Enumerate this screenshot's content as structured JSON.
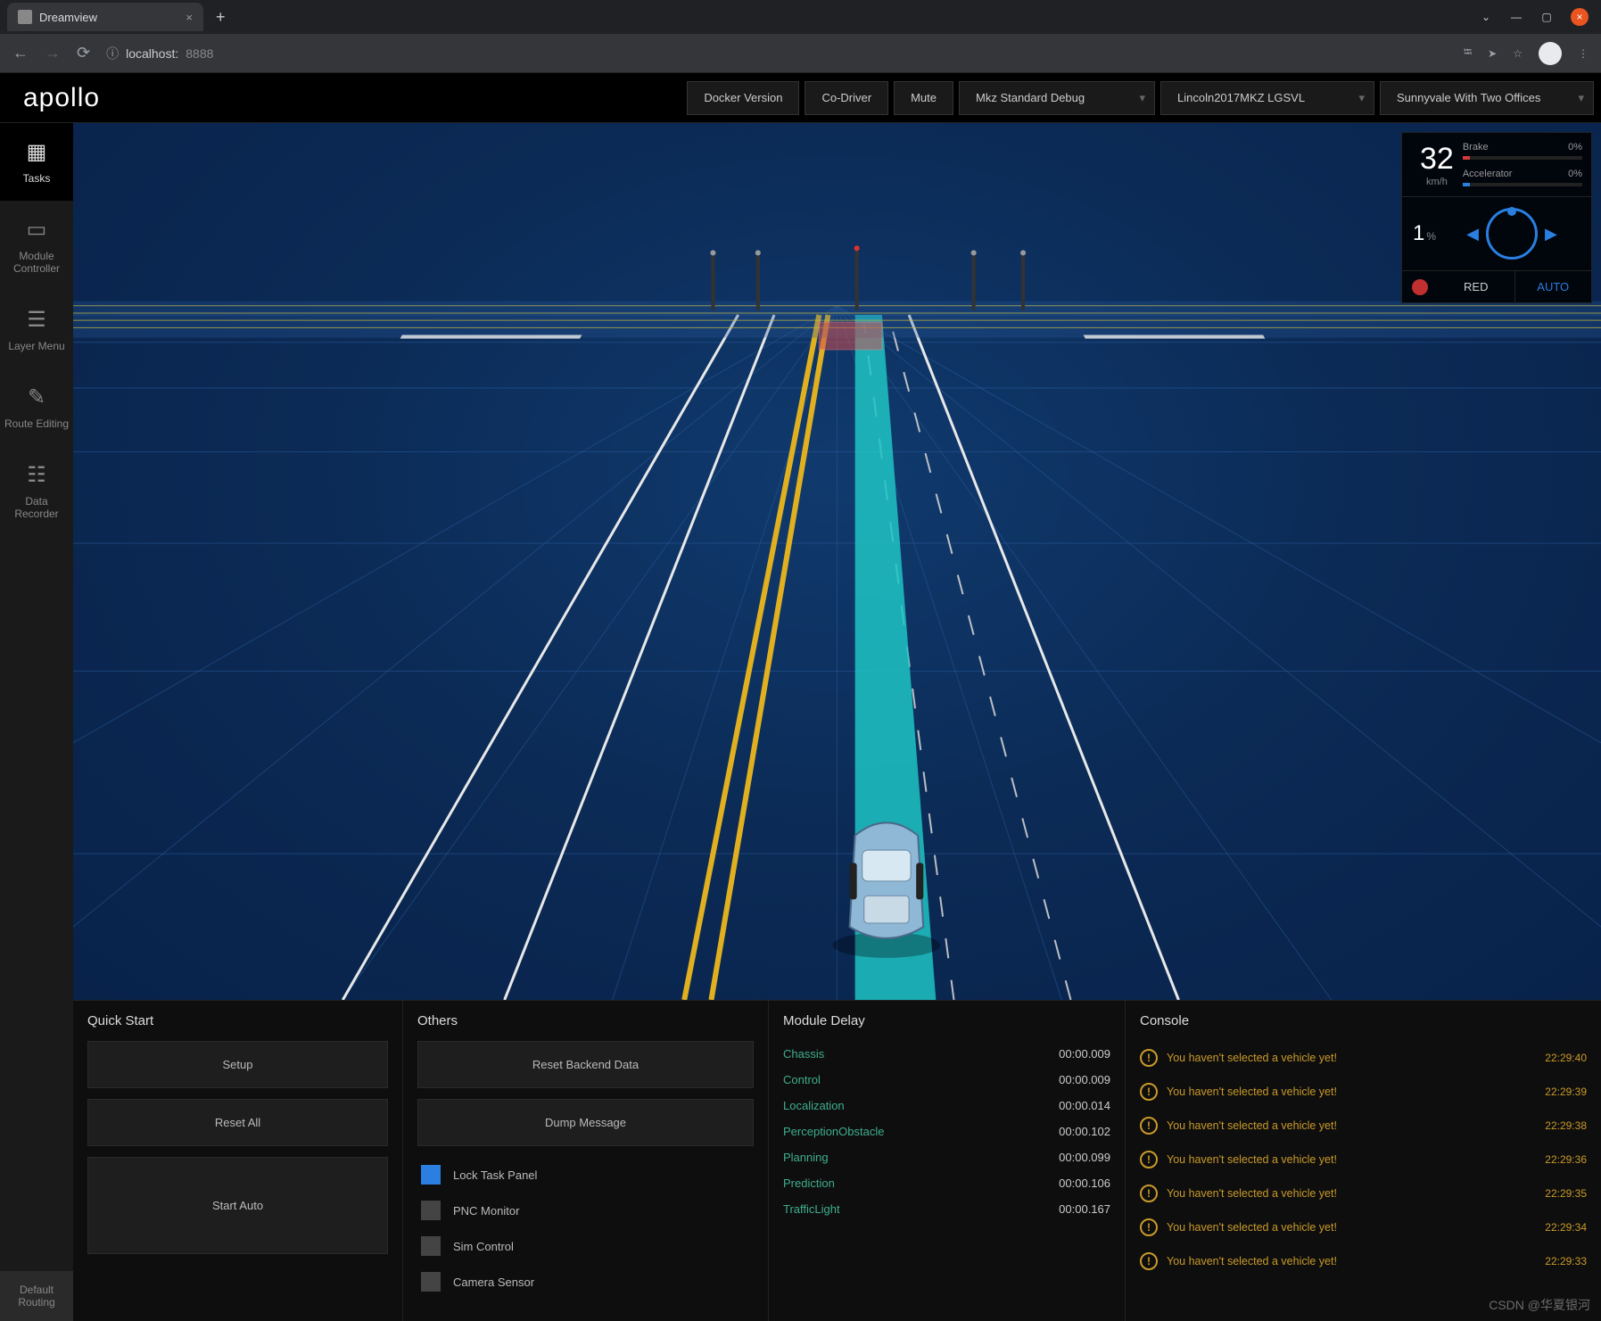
{
  "browser": {
    "tab_title": "Dreamview",
    "url_host": "localhost:",
    "url_port": "8888"
  },
  "header": {
    "logo": "apollo",
    "buttons": {
      "docker": "Docker Version",
      "codriver": "Co-Driver",
      "mute": "Mute"
    },
    "selects": {
      "mode": "Mkz Standard Debug",
      "vehicle": "Lincoln2017MKZ LGSVL",
      "map": "Sunnyvale With Two Offices"
    }
  },
  "sidebar": {
    "items": [
      {
        "label": "Tasks",
        "icon": "grid"
      },
      {
        "label": "Module Controller",
        "icon": "monitor"
      },
      {
        "label": "Layer Menu",
        "icon": "layers"
      },
      {
        "label": "Route Editing",
        "icon": "edit"
      },
      {
        "label": "Data Recorder",
        "icon": "record"
      }
    ],
    "bottom": "Default Routing"
  },
  "hud": {
    "speed": "32",
    "speed_unit": "km/h",
    "brake_label": "Brake",
    "brake_pct": "0%",
    "accel_label": "Accelerator",
    "accel_pct": "0%",
    "steer_pct": "1",
    "steer_unit": "%",
    "red": "RED",
    "auto": "AUTO"
  },
  "panels": {
    "quickstart": {
      "title": "Quick Start",
      "setup": "Setup",
      "reset": "Reset All",
      "startauto": "Start Auto"
    },
    "others": {
      "title": "Others",
      "resetbackend": "Reset Backend Data",
      "dump": "Dump Message",
      "checks": [
        {
          "label": "Lock Task Panel",
          "on": true
        },
        {
          "label": "PNC Monitor",
          "on": false
        },
        {
          "label": "Sim Control",
          "on": false
        },
        {
          "label": "Camera Sensor",
          "on": false
        }
      ]
    },
    "delay": {
      "title": "Module Delay",
      "rows": [
        {
          "name": "Chassis",
          "val": "00:00.009"
        },
        {
          "name": "Control",
          "val": "00:00.009"
        },
        {
          "name": "Localization",
          "val": "00:00.014"
        },
        {
          "name": "PerceptionObstacle",
          "val": "00:00.102"
        },
        {
          "name": "Planning",
          "val": "00:00.099"
        },
        {
          "name": "Prediction",
          "val": "00:00.106"
        },
        {
          "name": "TrafficLight",
          "val": "00:00.167"
        }
      ]
    },
    "console": {
      "title": "Console",
      "rows": [
        {
          "msg": "You haven't selected a vehicle yet!",
          "ts": "22:29:40"
        },
        {
          "msg": "You haven't selected a vehicle yet!",
          "ts": "22:29:39"
        },
        {
          "msg": "You haven't selected a vehicle yet!",
          "ts": "22:29:38"
        },
        {
          "msg": "You haven't selected a vehicle yet!",
          "ts": "22:29:36"
        },
        {
          "msg": "You haven't selected a vehicle yet!",
          "ts": "22:29:35"
        },
        {
          "msg": "You haven't selected a vehicle yet!",
          "ts": "22:29:34"
        },
        {
          "msg": "You haven't selected a vehicle yet!",
          "ts": "22:29:33"
        }
      ]
    }
  },
  "watermark": "CSDN @华夏银河"
}
